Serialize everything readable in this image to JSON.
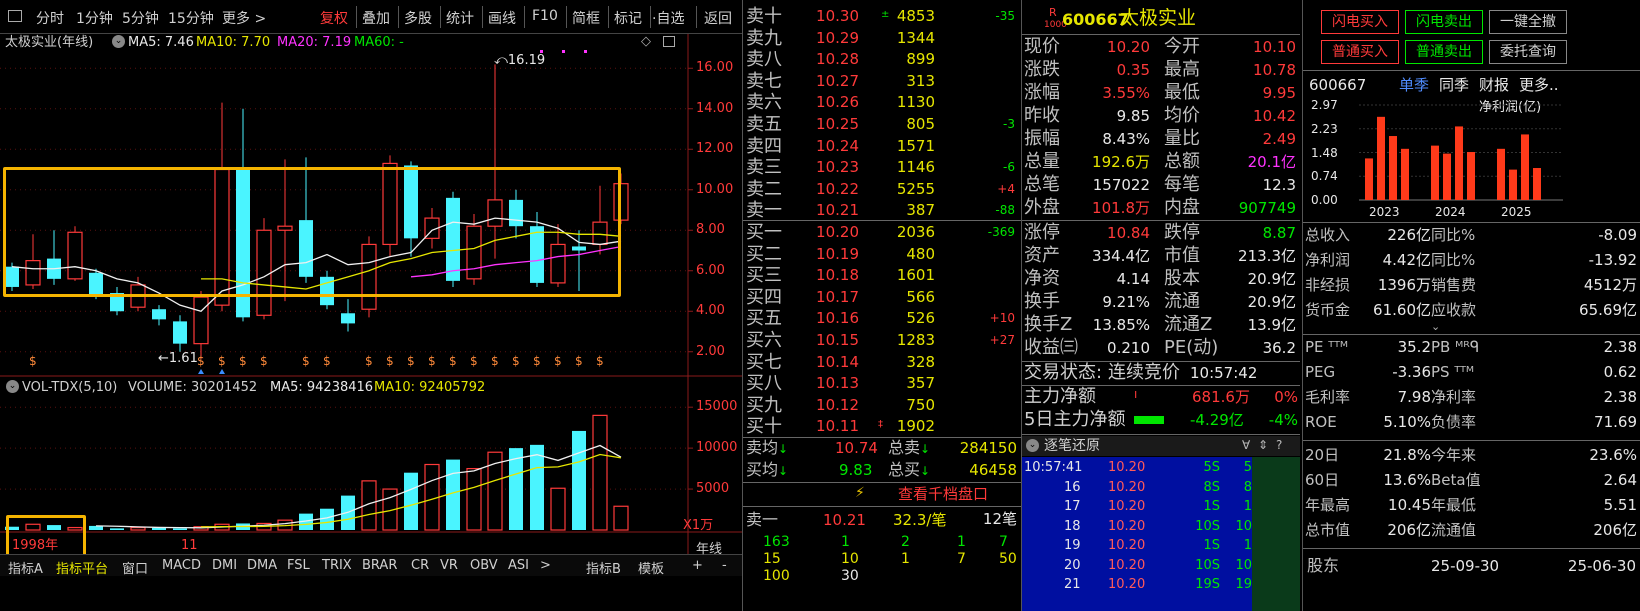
{
  "toolbar": {
    "items": [
      "分时",
      "1分钟",
      "5分钟",
      "15分钟",
      "更多 >",
      "复权",
      "叠加",
      "多股",
      "统计",
      "画线",
      "F10",
      "简框",
      "标记",
      "·自选",
      "返回"
    ]
  },
  "kline": {
    "title": "太极实业(年线)",
    "ma5": "MA5: 7.46",
    "ma10": "MA10: 7.70",
    "ma20": "MA20: 7.19",
    "ma60": "MA60: -",
    "max_label": "16.19",
    "min_label": "1.61",
    "y_ticks": [
      "16.00",
      "14.00",
      "12.00",
      "10.00",
      "8.00",
      "6.00",
      "4.00",
      "2.00"
    ],
    "start_year": "1998年",
    "x_mid_label": "11",
    "dividend_marker": "$"
  },
  "volume": {
    "title": "VOL-TDX(5,10)",
    "volume": "VOLUME: 30201452",
    "ma5": "MA5: 94238416",
    "ma10": "MA10: 92405792",
    "y_ticks": [
      "15000",
      "10000",
      "5000"
    ],
    "unit": "X1万"
  },
  "chart_data": {
    "type": "candlestick",
    "ylim": [
      1.0,
      17.0
    ],
    "candles": [
      {
        "o": 6.2,
        "c": 5.2,
        "h": 6.4,
        "l": 5.0
      },
      {
        "o": 5.3,
        "c": 6.5,
        "h": 7.8,
        "l": 5.1
      },
      {
        "o": 6.6,
        "c": 5.6,
        "h": 8.0,
        "l": 5.3
      },
      {
        "o": 5.6,
        "c": 7.9,
        "h": 8.2,
        "l": 5.5
      },
      {
        "o": 5.9,
        "c": 4.8,
        "h": 6.1,
        "l": 4.6
      },
      {
        "o": 4.9,
        "c": 4.0,
        "h": 5.2,
        "l": 3.8
      },
      {
        "o": 4.2,
        "c": 5.3,
        "h": 5.7,
        "l": 4.0
      },
      {
        "o": 4.1,
        "c": 3.6,
        "h": 4.3,
        "l": 3.3
      },
      {
        "o": 3.5,
        "c": 2.4,
        "h": 3.8,
        "l": 2.0
      },
      {
        "o": 2.4,
        "c": 4.7,
        "h": 5.0,
        "l": 1.61
      },
      {
        "o": 4.3,
        "c": 11.0,
        "h": 14.3,
        "l": 4.0
      },
      {
        "o": 11.0,
        "c": 3.7,
        "h": 14.0,
        "l": 3.5
      },
      {
        "o": 3.8,
        "c": 8.0,
        "h": 8.6,
        "l": 3.6
      },
      {
        "o": 8.0,
        "c": 8.2,
        "h": 11.5,
        "l": 4.5
      },
      {
        "o": 8.5,
        "c": 5.7,
        "h": 11.6,
        "l": 5.4
      },
      {
        "o": 5.7,
        "c": 4.3,
        "h": 6.0,
        "l": 4.1
      },
      {
        "o": 3.9,
        "c": 3.4,
        "h": 4.6,
        "l": 3.0
      },
      {
        "o": 4.1,
        "c": 7.3,
        "h": 7.7,
        "l": 3.7
      },
      {
        "o": 7.3,
        "c": 11.3,
        "h": 11.7,
        "l": 6.7
      },
      {
        "o": 11.2,
        "c": 7.6,
        "h": 11.4,
        "l": 6.7
      },
      {
        "o": 7.6,
        "c": 8.6,
        "h": 9.1,
        "l": 7.1
      },
      {
        "o": 9.6,
        "c": 5.5,
        "h": 9.9,
        "l": 5.2
      },
      {
        "o": 5.6,
        "c": 8.2,
        "h": 8.8,
        "l": 5.3
      },
      {
        "o": 8.2,
        "c": 9.5,
        "h": 16.19,
        "l": 6.6
      },
      {
        "o": 9.5,
        "c": 8.2,
        "h": 10.0,
        "l": 7.6
      },
      {
        "o": 8.2,
        "c": 5.4,
        "h": 8.9,
        "l": 5.2
      },
      {
        "o": 5.4,
        "c": 7.3,
        "h": 8.3,
        "l": 5.2
      },
      {
        "o": 7.2,
        "c": 7.0,
        "h": 8.0,
        "l": 5.0
      },
      {
        "o": 7.3,
        "c": 8.4,
        "h": 10.2,
        "l": 6.8
      },
      {
        "o": 8.5,
        "c": 10.3,
        "h": 10.8,
        "l": 8.3
      }
    ],
    "ma5": [
      6.2,
      6.1,
      6.1,
      6.2,
      6.0,
      5.6,
      5.4,
      4.9,
      4.3,
      4.0,
      5.0,
      5.3,
      5.7,
      6.3,
      6.4,
      6.8,
      6.3,
      6.4,
      6.7,
      6.9,
      8.0,
      8.4,
      8.3,
      8.6,
      8.5,
      8.4,
      8.1,
      7.4,
      7.3,
      7.46
    ],
    "ma10": [
      null,
      null,
      null,
      null,
      null,
      null,
      null,
      null,
      null,
      5.6,
      5.6,
      5.4,
      5.3,
      5.2,
      5.1,
      5.4,
      5.7,
      6.0,
      6.4,
      6.6,
      6.9,
      7.0,
      7.1,
      7.5,
      7.7,
      7.9,
      7.9,
      7.8,
      7.8,
      7.7
    ],
    "ma20": [
      null,
      null,
      null,
      null,
      null,
      null,
      null,
      null,
      null,
      null,
      null,
      null,
      null,
      null,
      null,
      null,
      null,
      null,
      null,
      5.7,
      5.8,
      6.0,
      6.1,
      6.3,
      6.4,
      6.5,
      6.7,
      6.8,
      7.0,
      7.19
    ],
    "vol": [
      400,
      700,
      600,
      300,
      500,
      200,
      300,
      250,
      200,
      400,
      700,
      800,
      800,
      1200,
      2000,
      2600,
      4200,
      6000,
      5000,
      7000,
      8000,
      8600,
      7500,
      9500,
      10000,
      10400,
      5100,
      12100,
      14000,
      2900
    ],
    "vol_ylim": [
      0,
      16000
    ]
  },
  "orderbook": {
    "sells": [
      {
        "label": "卖十",
        "price": "10.30",
        "vol": "4853",
        "chg": "-35"
      },
      {
        "label": "卖九",
        "price": "10.29",
        "vol": "1344",
        "chg": ""
      },
      {
        "label": "卖八",
        "price": "10.28",
        "vol": "899",
        "chg": ""
      },
      {
        "label": "卖七",
        "price": "10.27",
        "vol": "313",
        "chg": ""
      },
      {
        "label": "卖六",
        "price": "10.26",
        "vol": "1130",
        "chg": ""
      },
      {
        "label": "卖五",
        "price": "10.25",
        "vol": "805",
        "chg": "-3"
      },
      {
        "label": "卖四",
        "price": "10.24",
        "vol": "1571",
        "chg": ""
      },
      {
        "label": "卖三",
        "price": "10.23",
        "vol": "1146",
        "chg": "-6"
      },
      {
        "label": "卖二",
        "price": "10.22",
        "vol": "5255",
        "chg": "+4"
      },
      {
        "label": "卖一",
        "price": "10.21",
        "vol": "387",
        "chg": "-88"
      }
    ],
    "buys": [
      {
        "label": "买一",
        "price": "10.20",
        "vol": "2036",
        "chg": "-369"
      },
      {
        "label": "买二",
        "price": "10.19",
        "vol": "480",
        "chg": ""
      },
      {
        "label": "买三",
        "price": "10.18",
        "vol": "1601",
        "chg": ""
      },
      {
        "label": "买四",
        "price": "10.17",
        "vol": "566",
        "chg": ""
      },
      {
        "label": "买五",
        "price": "10.16",
        "vol": "526",
        "chg": "+10"
      },
      {
        "label": "买六",
        "price": "10.15",
        "vol": "1283",
        "chg": "+27"
      },
      {
        "label": "买七",
        "price": "10.14",
        "vol": "328",
        "chg": ""
      },
      {
        "label": "买八",
        "price": "10.13",
        "vol": "357",
        "chg": ""
      },
      {
        "label": "买九",
        "price": "10.12",
        "vol": "750",
        "chg": ""
      },
      {
        "label": "买十",
        "price": "10.11",
        "vol": "1902",
        "chg": ""
      }
    ],
    "avg_sell_label": "卖均",
    "avg_sell": "10.74",
    "total_sell_label": "总卖",
    "total_sell": "284150",
    "avg_buy_label": "买均",
    "avg_buy": "9.83",
    "total_buy_label": "总买",
    "total_buy": "46458",
    "depth_link": "查看千档盘口",
    "level1_label": "卖一",
    "level1_price": "10.21",
    "level1_per": "32.3/笔",
    "level1_count": "12笔",
    "queue": [
      [
        "163",
        "1",
        "2",
        "1",
        "7"
      ],
      [
        "15",
        "10",
        "1",
        "7",
        "50"
      ],
      [
        "100",
        "30",
        "",
        "",
        ""
      ]
    ]
  },
  "info": {
    "market_badge_top": "R",
    "market_badge_bottom": "1000",
    "code": "600667",
    "name": "太极实业",
    "rows": [
      {
        "l1": "现价",
        "v1": "10.20",
        "c1": "red",
        "l2": "今开",
        "v2": "10.10",
        "c2": "red"
      },
      {
        "l1": "涨跌",
        "v1": "0.35",
        "c1": "red",
        "l2": "最高",
        "v2": "10.78",
        "c2": "red"
      },
      {
        "l1": "涨幅",
        "v1": "3.55%",
        "c1": "red",
        "l2": "最低",
        "v2": "9.95",
        "c2": "red"
      },
      {
        "l1": "昨收",
        "v1": "9.85",
        "c1": "wht",
        "l2": "均价",
        "v2": "10.42",
        "c2": "red"
      },
      {
        "l1": "振幅",
        "v1": "8.43%",
        "c1": "wht",
        "l2": "量比",
        "v2": "2.49",
        "c2": "red"
      },
      {
        "l1": "总量",
        "v1": "192.6万",
        "c1": "yel",
        "l2": "总额",
        "v2": "20.1亿",
        "c2": "mag"
      },
      {
        "l1": "总笔",
        "v1": "157022",
        "c1": "wht",
        "l2": "每笔",
        "v2": "12.3",
        "c2": "wht"
      },
      {
        "l1": "外盘",
        "v1": "101.8万",
        "c1": "red",
        "l2": "内盘",
        "v2": "907749",
        "c2": "grn"
      },
      {
        "l1": "涨停",
        "v1": "10.84",
        "c1": "red",
        "l2": "跌停",
        "v2": "8.87",
        "c2": "grn"
      },
      {
        "l1": "资产",
        "v1": "334.4亿",
        "c1": "wht",
        "l2": "市值",
        "v2": "213.3亿",
        "c2": "wht"
      },
      {
        "l1": "净资",
        "v1": "4.14",
        "c1": "wht",
        "l2": "股本",
        "v2": "20.9亿",
        "c2": "wht"
      },
      {
        "l1": "换手",
        "v1": "9.21%",
        "c1": "wht",
        "l2": "流通",
        "v2": "20.9亿",
        "c2": "wht"
      },
      {
        "l1": "换手Z",
        "v1": "13.85%",
        "c1": "wht",
        "l2": "流通Z",
        "v2": "13.9亿",
        "c2": "wht"
      },
      {
        "l1": "收益㈢",
        "v1": "0.210",
        "c1": "wht",
        "l2": "PE(动)",
        "v2": "36.2",
        "c2": "wht"
      }
    ],
    "status_label": "交易状态:",
    "status": "连续竞价",
    "time": "10:57:42",
    "main_net_label": "主力净额",
    "main_net": "681.6万",
    "main_net_pct": "0%",
    "main_net5_label": "5日主力净额",
    "main_net5": "-4.29亿",
    "main_net5_pct": "-4%",
    "ticks_title": "逐笔还原",
    "ticks": [
      [
        "10:57:41",
        "10.20",
        "5S",
        "5"
      ],
      [
        "16",
        "10.20",
        "8S",
        "8"
      ],
      [
        "17",
        "10.20",
        "1S",
        "1"
      ],
      [
        "18",
        "10.20",
        "10S",
        "10"
      ],
      [
        "19",
        "10.20",
        "1S",
        "1"
      ],
      [
        "20",
        "10.20",
        "10S",
        "10"
      ],
      [
        "21",
        "10.20",
        "19S",
        "19"
      ]
    ]
  },
  "right": {
    "buttons": [
      {
        "label": "闪电买入",
        "color": "#ff3a3a"
      },
      {
        "label": "闪电卖出",
        "color": "#00e600"
      },
      {
        "label": "一键全撤",
        "color": "#d0d0d0"
      },
      {
        "label": "普通买入",
        "color": "#ff3a3a"
      },
      {
        "label": "普通卖出",
        "color": "#00e600"
      },
      {
        "label": "委托查询",
        "color": "#d0d0d0"
      }
    ],
    "code": "600667",
    "tabs": [
      "单季",
      "同季",
      "财报",
      "更多.."
    ],
    "profit_title": "净利润(亿)",
    "profit_ticks": [
      "2.97",
      "2.23",
      "1.48",
      "0.74",
      "0.00"
    ],
    "profit_years": [
      "2023",
      "2024",
      "2025"
    ],
    "profit_bars": [
      1.3,
      2.6,
      2.0,
      1.6,
      1.7,
      1.45,
      2.3,
      1.5,
      1.6,
      0.95,
      2.05,
      1.0
    ],
    "profit_ylim": [
      0,
      2.97
    ],
    "fin1": [
      {
        "a": "总收入",
        "b": "226亿",
        "c": "同比%",
        "d": "-8.09"
      },
      {
        "a": "净利润",
        "b": "4.42亿",
        "c": "同比%",
        "d": "-13.92"
      },
      {
        "a": "非经损",
        "b": "1396万",
        "c": "销售费",
        "d": "4512万"
      },
      {
        "a": "货币金",
        "b": "61.60亿",
        "c": "应收款",
        "d": "65.69亿"
      }
    ],
    "fin2": [
      {
        "a": "PE ᵀᵀᴹ",
        "b": "35.2",
        "c": "PB ᴹᴿᑫ",
        "d": "2.38"
      },
      {
        "a": "PEG",
        "b": "-3.36",
        "c": "PS ᵀᵀᴹ",
        "d": "0.62"
      },
      {
        "a": "毛利率",
        "b": "7.98",
        "c": "净利率",
        "d": "2.38"
      },
      {
        "a": "ROE",
        "b": "5.10%",
        "c": "负债率",
        "d": "71.69"
      }
    ],
    "fin3": [
      {
        "a": "20日",
        "b": "21.8%",
        "c": "今年来",
        "d": "23.6%"
      },
      {
        "a": "60日",
        "b": "13.6%",
        "c": "Beta值",
        "d": "2.64"
      },
      {
        "a": "年最高",
        "b": "10.45",
        "c": "年最低",
        "d": "5.51"
      },
      {
        "a": "总市值",
        "b": "206亿",
        "c": "流通值",
        "d": "206亿"
      }
    ],
    "holders_label": "股东",
    "holders_date1": "25-09-30",
    "holders_date2": "25-06-30"
  },
  "bottom_tabs": [
    "指标A",
    "指标平台",
    "窗口",
    "MACD",
    "DMI",
    "DMA",
    "FSL",
    "TRIX",
    "BRAR",
    "CR",
    "VR",
    "OBV",
    "ASI",
    ">",
    "指标B",
    "模板",
    "年线",
    "+",
    "-"
  ]
}
